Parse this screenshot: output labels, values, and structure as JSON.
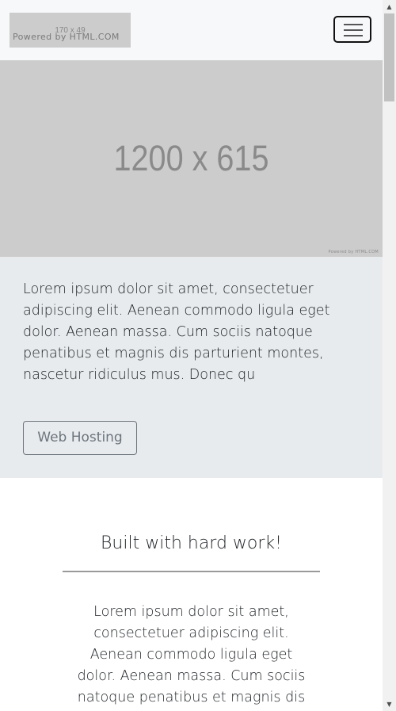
{
  "navbar": {
    "logo_size_text": "170 x 49",
    "logo_credit": "Powered by HTML.COM",
    "toggle_icon": "hamburger-menu-icon"
  },
  "hero": {
    "dimensions_text": "1200 x 615",
    "credit": "Powered by HTML.COM"
  },
  "intro": {
    "text": "Lorem ipsum dolor sit amet, consectetuer adipiscing elit. Aenean commodo ligula eget dolor. Aenean massa. Cum sociis natoque penatibus et magnis dis parturient montes, nascetur ridiculus mus. Donec qu",
    "button_label": "Web Hosting"
  },
  "built": {
    "heading": "Built with hard work!",
    "text": "Lorem ipsum dolor sit amet, consectetuer adipiscing elit. Aenean commodo ligula eget dolor. Aenean massa. Cum sociis natoque penatibus et magnis dis"
  },
  "scrollbar": {
    "up_arrow": "▲",
    "down_arrow": "▼"
  },
  "colors": {
    "navbar_bg": "#f7f8fa",
    "placeholder_gray": "#cccccc",
    "intro_bg": "#e8ebee",
    "button_outline": "#6c757d"
  }
}
